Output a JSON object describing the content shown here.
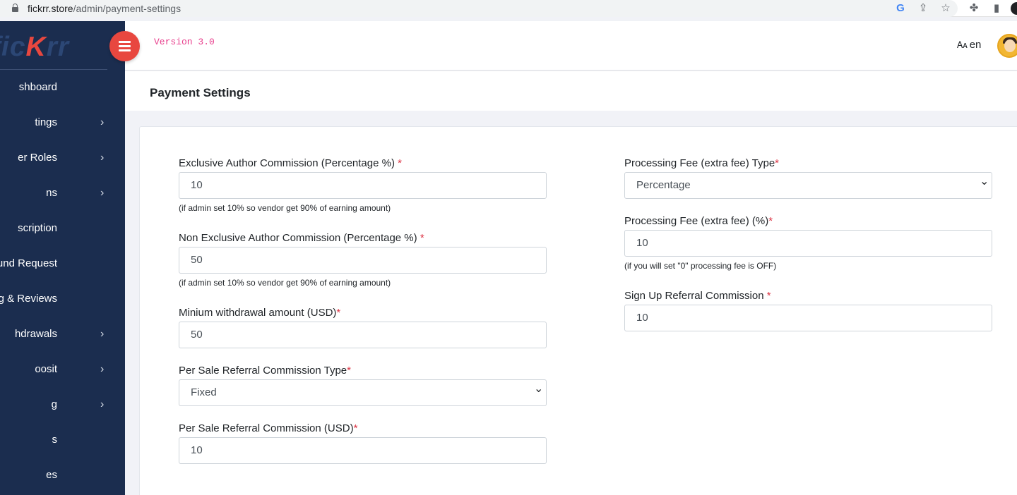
{
  "browser": {
    "url_host": "fickrr.store",
    "url_path": "/admin/payment-settings"
  },
  "sidebar": {
    "logo": {
      "part1": "fic",
      "part2": "K",
      "part3": "rr"
    },
    "items": [
      {
        "label": "shboard",
        "has_children": false
      },
      {
        "label": "tings",
        "has_children": true
      },
      {
        "label": "er Roles",
        "has_children": true
      },
      {
        "label": "ns",
        "has_children": true
      },
      {
        "label": "scription",
        "has_children": false
      },
      {
        "label": "und Request",
        "has_children": false
      },
      {
        "label": "ing & Reviews",
        "has_children": false
      },
      {
        "label": "hdrawals",
        "has_children": true
      },
      {
        "label": "oosit",
        "has_children": true
      },
      {
        "label": "g",
        "has_children": true
      },
      {
        "label": "s",
        "has_children": false
      },
      {
        "label": "es",
        "has_children": false
      }
    ]
  },
  "header": {
    "version": "Version 3.0",
    "language": "en"
  },
  "page": {
    "title": "Payment Settings"
  },
  "form": {
    "left": [
      {
        "label": "Exclusive Author Commission (Percentage %) ",
        "required": "*",
        "type": "input",
        "value": "10",
        "help": "(if admin set 10% so vendor get 90% of earning amount)"
      },
      {
        "label": "Non Exclusive Author Commission (Percentage %) ",
        "required": "*",
        "type": "input",
        "value": "50",
        "help": "(if admin set 10% so vendor get 90% of earning amount)"
      },
      {
        "label": "Minium withdrawal amount (USD)",
        "required": "*",
        "type": "input",
        "value": "50",
        "help": ""
      },
      {
        "label": "Per Sale Referral Commission Type",
        "required": "*",
        "type": "select",
        "value": "Fixed",
        "help": ""
      },
      {
        "label": "Per Sale Referral Commission (USD)",
        "required": "*",
        "type": "input",
        "value": "10",
        "help": ""
      }
    ],
    "right": [
      {
        "label": "Processing Fee (extra fee) Type",
        "required": "*",
        "type": "select",
        "value": "Percentage",
        "help": ""
      },
      {
        "label": "Processing Fee (extra fee) (%)",
        "required": "*",
        "type": "input",
        "value": "10",
        "help": "(if you will set \"0\" processing fee is OFF)"
      },
      {
        "label": "Sign Up Referral Commission ",
        "required": "*",
        "type": "input",
        "value": "10",
        "help": ""
      }
    ]
  },
  "colors": {
    "sidebar_bg": "#1b2d4f",
    "accent": "#e8473f",
    "version_text": "#e83e8c",
    "required": "#dc3545"
  }
}
